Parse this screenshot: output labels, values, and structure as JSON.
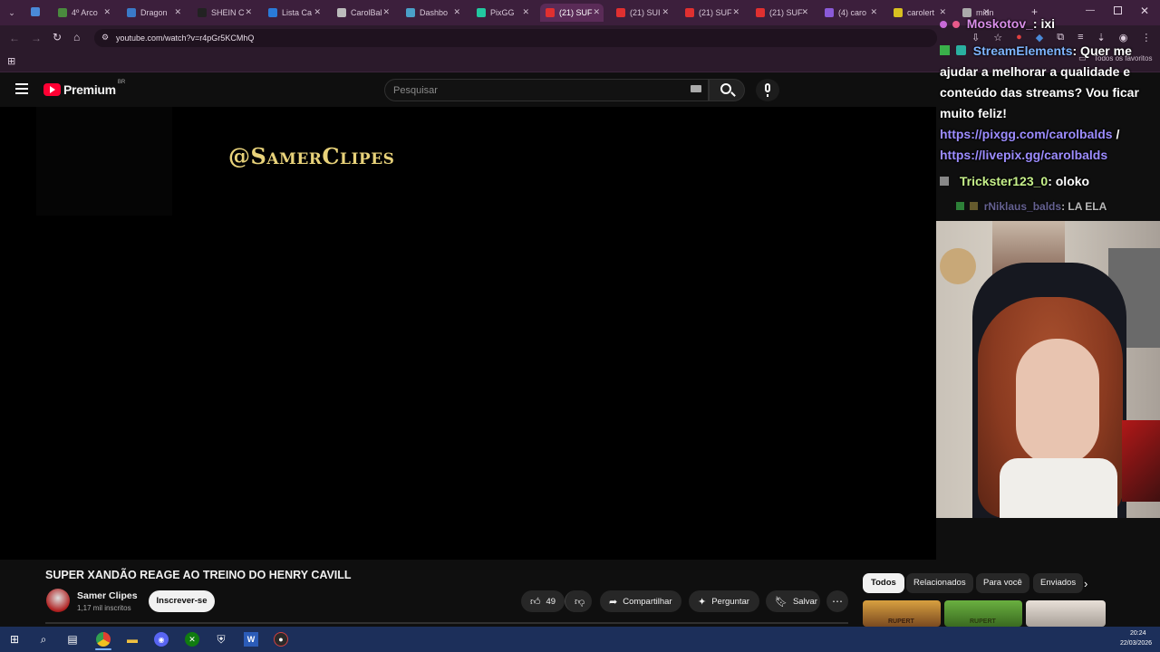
{
  "browser": {
    "tabs": [
      {
        "label": "4º Arco",
        "color": "#4a8a3e"
      },
      {
        "label": "Dragon",
        "color": "#3a7ac8"
      },
      {
        "label": "SHEIN C",
        "color": "#222222"
      },
      {
        "label": "Lista Ca",
        "color": "#2a7ad8"
      },
      {
        "label": "CarolBal",
        "color": "#bbbbbb"
      },
      {
        "label": "Dashbo",
        "color": "#4aa0c8"
      },
      {
        "label": "PixGG",
        "color": "#22c8a0"
      },
      {
        "label": "(21) SUF",
        "color": "#e03030"
      },
      {
        "label": "(21) SUI",
        "color": "#e03030"
      },
      {
        "label": "(21) SUF",
        "color": "#e03030"
      },
      {
        "label": "(21) SUF",
        "color": "#e03030"
      },
      {
        "label": "(4) caro",
        "color": "#8a5ad8"
      },
      {
        "label": "carolert",
        "color": "#d8c020"
      },
      {
        "label": "midnig",
        "color": "#aaaaaa"
      }
    ],
    "url": "youtube.com/watch?v=r4pGr5KCMhQ",
    "bookmarks_label": "Todos os favoritos"
  },
  "youtube": {
    "logo_text": "Premium",
    "region_badge": "BR",
    "search_placeholder": "Pesquisar",
    "watermark": "@SamerClipes",
    "video_title": "SUPER XANDÃO REAGE AO TREINO DO HENRY CAVILL",
    "channel_name": "Samer Clipes",
    "subscribers": "1,17 mil inscritos",
    "subscribe_label": "Inscrever-se",
    "likes": "49",
    "share_label": "Compartilhar",
    "ask_label": "Perguntar",
    "save_label": "Salvar",
    "filter_chips": [
      "Todos",
      "Relacionados",
      "Para você",
      "Enviados"
    ],
    "thumb_labels": [
      "RUPERT",
      "RUPERT"
    ]
  },
  "chat": {
    "line1_user": "Moskotov_",
    "line1_msg": ": ixi",
    "line2_user": "StreamElements",
    "line2_msg": ": Quer me ajudar a melhorar a qualidade e conteúdo das streams? Vou ficar muito feliz!",
    "link1": "https://pixgg.com/carolbalds",
    "link_sep": "/",
    "link2": "https://livepix.gg/carolbalds",
    "line3_user": "Trickster123_0",
    "line3_msg": ": oloko",
    "line4_user": "rNiklaus_balds",
    "line4_msg": ": LA ELA",
    "colors": {
      "moskotov": "#d98ee8",
      "streamelements": "#7fb5ff",
      "link": "#9c8cff",
      "trickster": "#c6f08a",
      "niklaus": "#8a84c8"
    }
  },
  "taskbar": {
    "time": "20:24",
    "date": "22/03/2026"
  }
}
